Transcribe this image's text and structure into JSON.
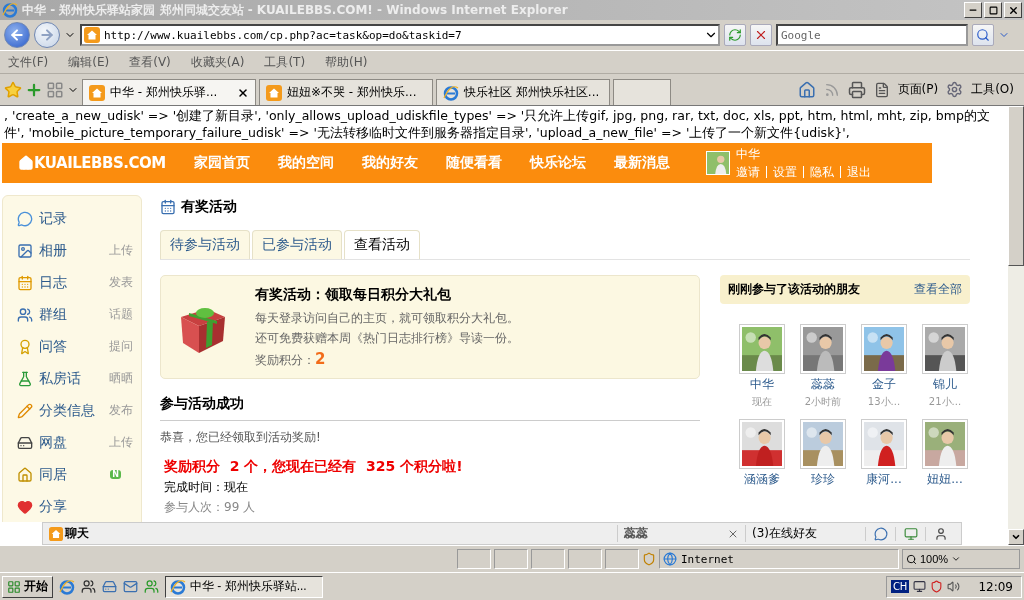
{
  "window": {
    "title": "中华 - 郑州快乐驿站家园 郑州同城交友站 - KUAILEBBS.COM! - Windows Internet Explorer"
  },
  "address_bar": {
    "url": "http://www.kuailebbs.com/cp.php?ac=task&op=do&taskid=7"
  },
  "search": {
    "placeholder": "Google"
  },
  "menu": [
    "文件(F)",
    "编辑(E)",
    "查看(V)",
    "收藏夹(A)",
    "工具(T)",
    "帮助(H)"
  ],
  "tabs": [
    {
      "label": "中华 - 郑州快乐驿...",
      "selected": true
    },
    {
      "label": "妞妞※不哭 - 郑州快乐...",
      "selected": false
    },
    {
      "label": "快乐社区 郑州快乐社区...",
      "selected": false
    }
  ],
  "command_bar": [
    "页面(P)",
    "工具(O)"
  ],
  "error_text": ", 'create_a_new_udisk' => '创建了新目录', 'only_allows_upload_udiskfile_types' => '只允许上传gif, jpg, png, rar, txt, doc, xls, ppt, htm, html, mht, zip, bmp的文件', 'mobile_picture_temporary_failure_udisk' => '无法转移临时文件到服务器指定目录', 'upload_a_new_file' => '上传了一个新文件{udisk}',",
  "site": {
    "logo": "KUAILEBBS.COM",
    "nav": [
      "家园首页",
      "我的空间",
      "我的好友",
      "随便看看",
      "快乐论坛",
      "最新消息"
    ],
    "user": {
      "name": "中华",
      "links": [
        "邀请",
        "设置",
        "隐私",
        "退出"
      ]
    }
  },
  "sidebar": [
    {
      "label": "记录"
    },
    {
      "label": "相册",
      "action": "上传"
    },
    {
      "label": "日志",
      "action": "发表"
    },
    {
      "label": "群组",
      "action": "话题"
    },
    {
      "label": "问答",
      "action": "提问"
    },
    {
      "label": "私房话",
      "action": "晒晒"
    },
    {
      "label": "分类信息",
      "action": "发布"
    },
    {
      "label": "网盘",
      "action": "上传"
    },
    {
      "label": "同居",
      "badge": "N"
    },
    {
      "label": "分享"
    }
  ],
  "page": {
    "title": "有奖活动",
    "tabs": [
      {
        "label": "待参与活动",
        "selected": false
      },
      {
        "label": "已参与活动",
        "selected": false
      },
      {
        "label": "查看活动",
        "selected": true
      }
    ]
  },
  "task": {
    "title": "有奖活动：领取每日积分大礼包",
    "lines": [
      "每天登录访问自己的主页，就可领取积分大礼包。",
      "还可免费获赠本周《热门日志排行榜》导读一份。"
    ],
    "reward_label": "奖励积分：",
    "reward": "2"
  },
  "result": {
    "heading": "参与活动成功",
    "message": "恭喜，您已经领取到活动奖励!",
    "reward_line": "奖励积分  2 个，您现在已经有  325 个积分啦!",
    "done": "完成时间：现在",
    "participants_label": "参与人次：",
    "participants": "99 人"
  },
  "friends": {
    "title": "刚刚参与了该活动的朋友",
    "more": "查看全部",
    "items": [
      {
        "name": "中华",
        "time": "现在"
      },
      {
        "name": "蕊蕊",
        "time": "2小时前"
      },
      {
        "name": "金子",
        "time": "13小..."
      },
      {
        "name": "锦儿",
        "time": "21小..."
      },
      {
        "name": "涵涵爹"
      },
      {
        "name": "珍珍"
      },
      {
        "name": "康河..."
      },
      {
        "name": "妞妞..."
      }
    ]
  },
  "chat": {
    "title": "聊天",
    "contact": "蕊蕊",
    "online": "(3)在线好友"
  },
  "status_bar": {
    "zone": "Internet",
    "zoom": "100%"
  },
  "taskbar": {
    "start": "开始",
    "windows": [
      {
        "label": "中华 - 郑州快乐驿站...",
        "selected": true
      }
    ],
    "ime": "CH",
    "time": "12:09"
  }
}
